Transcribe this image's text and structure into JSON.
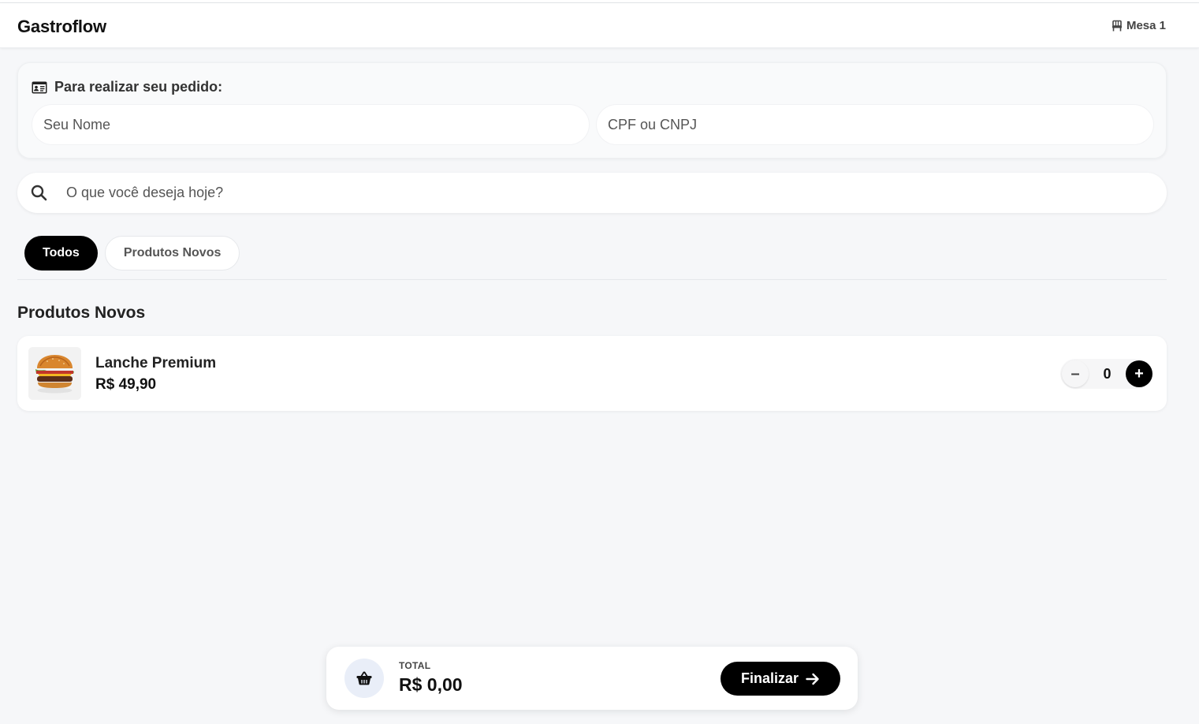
{
  "app": {
    "brand": "Gastroflow",
    "table_label": "Mesa 1"
  },
  "order_form": {
    "title": "Para realizar seu pedido:",
    "name_placeholder": "Seu Nome",
    "name_value": "",
    "doc_placeholder": "CPF ou CNPJ",
    "doc_value": ""
  },
  "search": {
    "placeholder": "O que você deseja hoje?",
    "value": ""
  },
  "categories": [
    {
      "label": "Todos",
      "active": true
    },
    {
      "label": "Produtos Novos",
      "active": false
    }
  ],
  "section": {
    "title": "Produtos Novos"
  },
  "products": [
    {
      "name": "Lanche Premium",
      "price": "R$ 49,90",
      "quantity": "0"
    }
  ],
  "cart": {
    "total_label": "TOTAL",
    "total_value": "R$ 0,00",
    "finalize_label": "Finalizar"
  },
  "icons": {
    "header": "chair-icon",
    "order_form": "id-card-icon",
    "search": "search-icon",
    "cart": "basket-icon",
    "finalize": "arrow-right-icon"
  },
  "colors": {
    "accent": "#000000",
    "background": "#f6f7f9",
    "card": "#ffffff"
  }
}
